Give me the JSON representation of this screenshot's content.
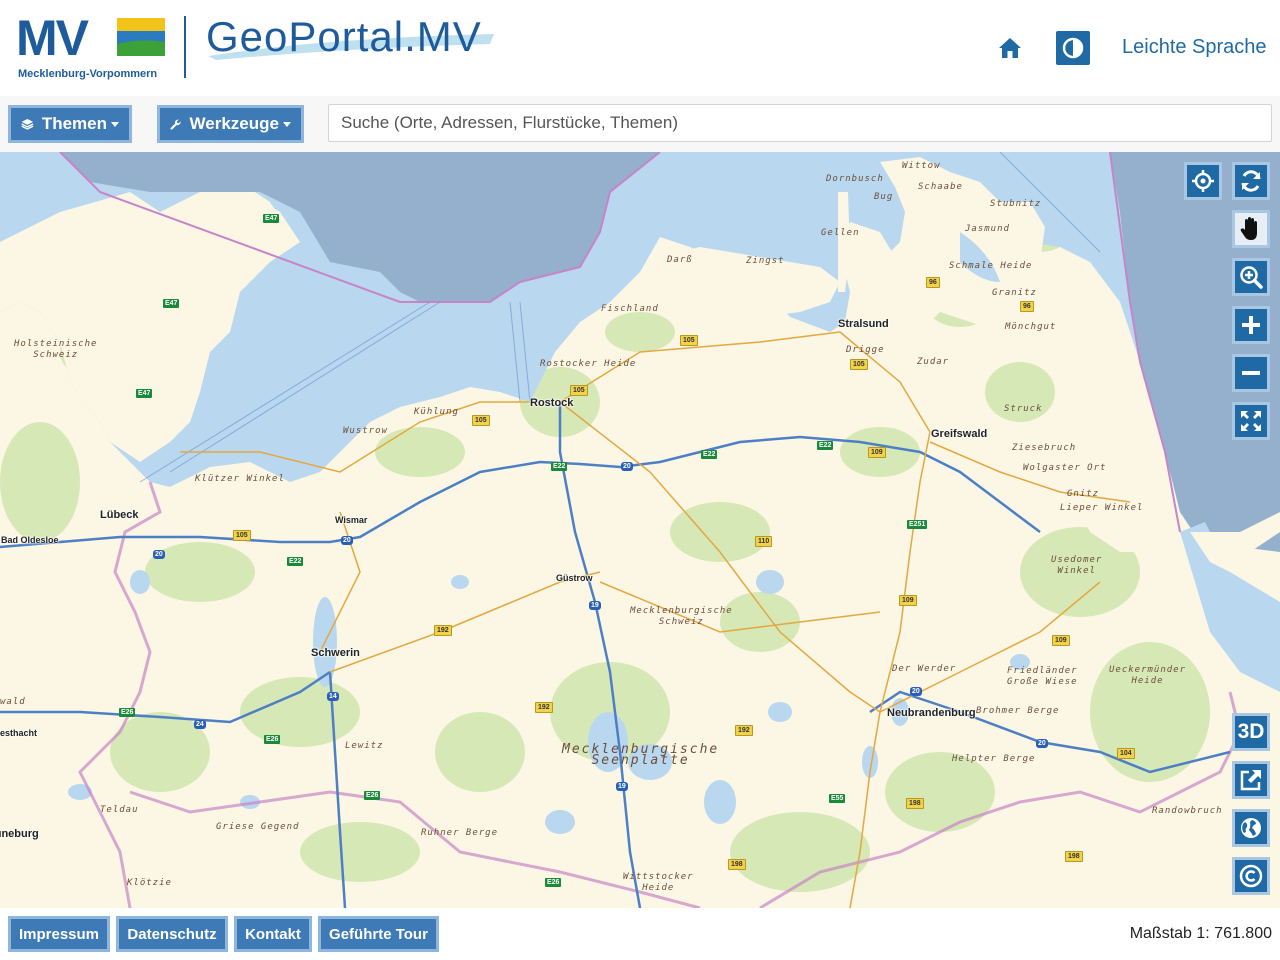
{
  "header": {
    "logo_letters": "MV",
    "logo_subtitle": "Mecklenburg-Vorpommern",
    "portal_title": "GeoPortal.MV",
    "easy_language": "Leichte Sprache"
  },
  "toolbar": {
    "themes_label": "Themen",
    "tools_label": "Werkzeuge",
    "search_placeholder": "Suche (Orte, Adressen, Flurstücke, Themen)"
  },
  "map": {
    "map_tools": {
      "three_d_label": "3D"
    },
    "cities": [
      "Stralsund",
      "Rostock",
      "Greifswald",
      "Lübeck",
      "Bad Oldesloe",
      "Wismar",
      "Güstrow",
      "Schwerin",
      "Neubrandenburg",
      "Lüneburg"
    ],
    "landscapes": {
      "witow": "Wittow",
      "dornbusch": "Dornbusch",
      "schaabe": "Schaabe",
      "bug": "Bug",
      "stubnitz": "Stubnitz",
      "gellen": "Gellen",
      "jasmund": "Jasmund",
      "darss": "Darß",
      "zingst": "Zingst",
      "schmale_heide": "Schmale Heide",
      "granitz": "Granitz",
      "fischland": "Fischland",
      "moenchgut": "Mönchgut",
      "holsteinische_1": "Holsteinische",
      "holsteinische_2": "Schweiz",
      "rostocker_heide": "Rostocker Heide",
      "drigge": "Drigge",
      "zudar": "Zudar",
      "kuehlung": "Kühlung",
      "wustrow": "Wustrow",
      "struck": "Struck",
      "ziesebruch": "Ziesebruch",
      "wolgaster_ort": "Wolgaster Ort",
      "gnitz": "Gnitz",
      "lieper_winkel": "Lieper Winkel",
      "kluetzer_winkel": "Klützer Winkel",
      "usedomer_1": "Usedomer",
      "usedomer_2": "Winkel",
      "meck_schweiz_1": "Mecklenburgische",
      "meck_schweiz_2": "Schweiz",
      "der_werder": "Der Werder",
      "friedlaender_1": "Friedländer",
      "friedlaender_2": "Große Wiese",
      "ueckermuender_1": "Ueckermünder",
      "ueckermuender_2": "Heide",
      "brohmer_berge": "Brohmer Berge",
      "seenplatte_1": "Mecklenburgische",
      "seenplatte_2": "Seenplatte",
      "lewitz": "Lewitz",
      "helpter_berge": "Helpter Berge",
      "wald": "wald",
      "esthacht": "esthacht",
      "teldau": "Teldau",
      "griese_gegend": "Griese Gegend",
      "ruhner_berge": "Ruhner Berge",
      "randowbruch": "Randowbruch",
      "kloetzie": "Klötzie",
      "wittstocker_1": "Wittstocker",
      "wittstocker_2": "Heide"
    },
    "road_shields": {
      "a20": "20",
      "a19": "19",
      "a24": "24",
      "a14": "14",
      "e22": "E22",
      "e26": "E26",
      "e47": "E47",
      "e55": "E55",
      "e251": "E251",
      "b105": "105",
      "b96": "96",
      "b110": "110",
      "b109": "109",
      "b104": "104",
      "b192": "192",
      "b198": "198"
    }
  },
  "footer": {
    "impressum": "Impressum",
    "privacy": "Datenschutz",
    "contact": "Kontakt",
    "tour": "Geführte Tour",
    "scale": "Maßstab 1: 761.800"
  },
  "colors": {
    "brand_blue": "#1e5b9b",
    "button_blue": "#3e7bb6",
    "sea": "#b8d6ee",
    "deep_sea": "#94b0cc",
    "land": "#fbf7e4",
    "forest": "#d4e7b4",
    "state_border": "#c784c8"
  }
}
